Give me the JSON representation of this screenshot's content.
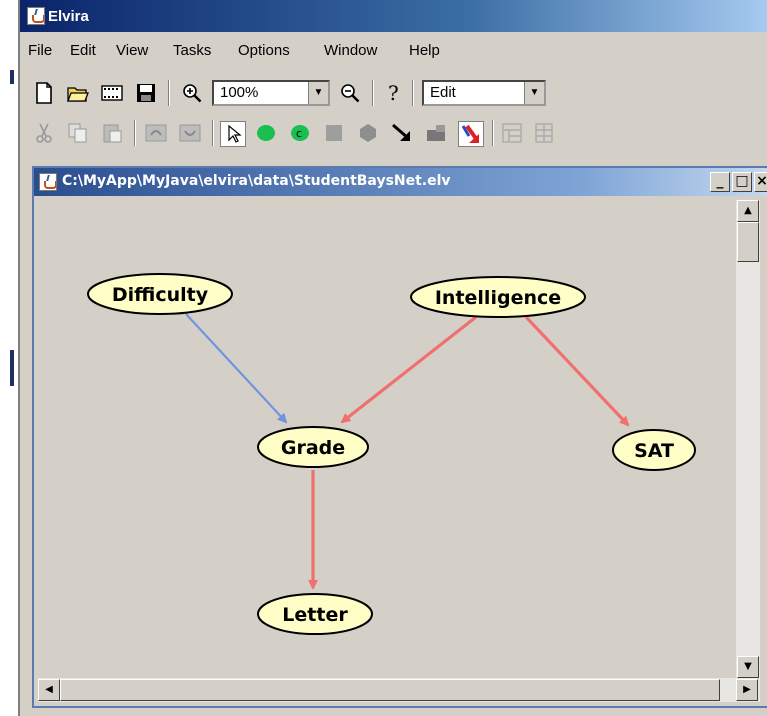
{
  "app": {
    "title": "Elvira"
  },
  "menu": [
    "File",
    "Edit",
    "View",
    "Tasks",
    "Options",
    "Window",
    "Help"
  ],
  "toolbar": {
    "zoom_value": "100%",
    "mode_value": "Edit",
    "icons_row1": [
      "new-file-icon",
      "open-folder-icon",
      "film-icon",
      "save-icon",
      "zoom-in-icon",
      "zoom-out-icon",
      "help-icon"
    ],
    "icons_row2": [
      "cut-icon",
      "copy-icon",
      "paste-icon",
      "undo-icon",
      "redo-icon",
      "select-arrow-icon",
      "node-icon",
      "node-c-icon",
      "gray-node-icon",
      "hexagon-icon",
      "link-arrow-icon",
      "black-block-icon",
      "red-link-icon",
      "tree-icon",
      "grid-icon"
    ]
  },
  "document": {
    "title": "C:\\MyApp\\MyJava\\elvira\\data\\StudentBaysNet.elv"
  },
  "network": {
    "nodes": [
      {
        "id": "difficulty",
        "label": "Difficulty"
      },
      {
        "id": "intelligence",
        "label": "Intelligence"
      },
      {
        "id": "grade",
        "label": "Grade"
      },
      {
        "id": "sat",
        "label": "SAT"
      },
      {
        "id": "letter",
        "label": "Letter"
      }
    ],
    "edges": [
      {
        "from": "difficulty",
        "to": "grade",
        "color": "#6f94e0"
      },
      {
        "from": "intelligence",
        "to": "grade",
        "color": "#f07070"
      },
      {
        "from": "intelligence",
        "to": "sat",
        "color": "#f07070"
      },
      {
        "from": "grade",
        "to": "letter",
        "color": "#f07070"
      }
    ],
    "node_fill": "#fefec6",
    "node_stroke": "#000000"
  }
}
